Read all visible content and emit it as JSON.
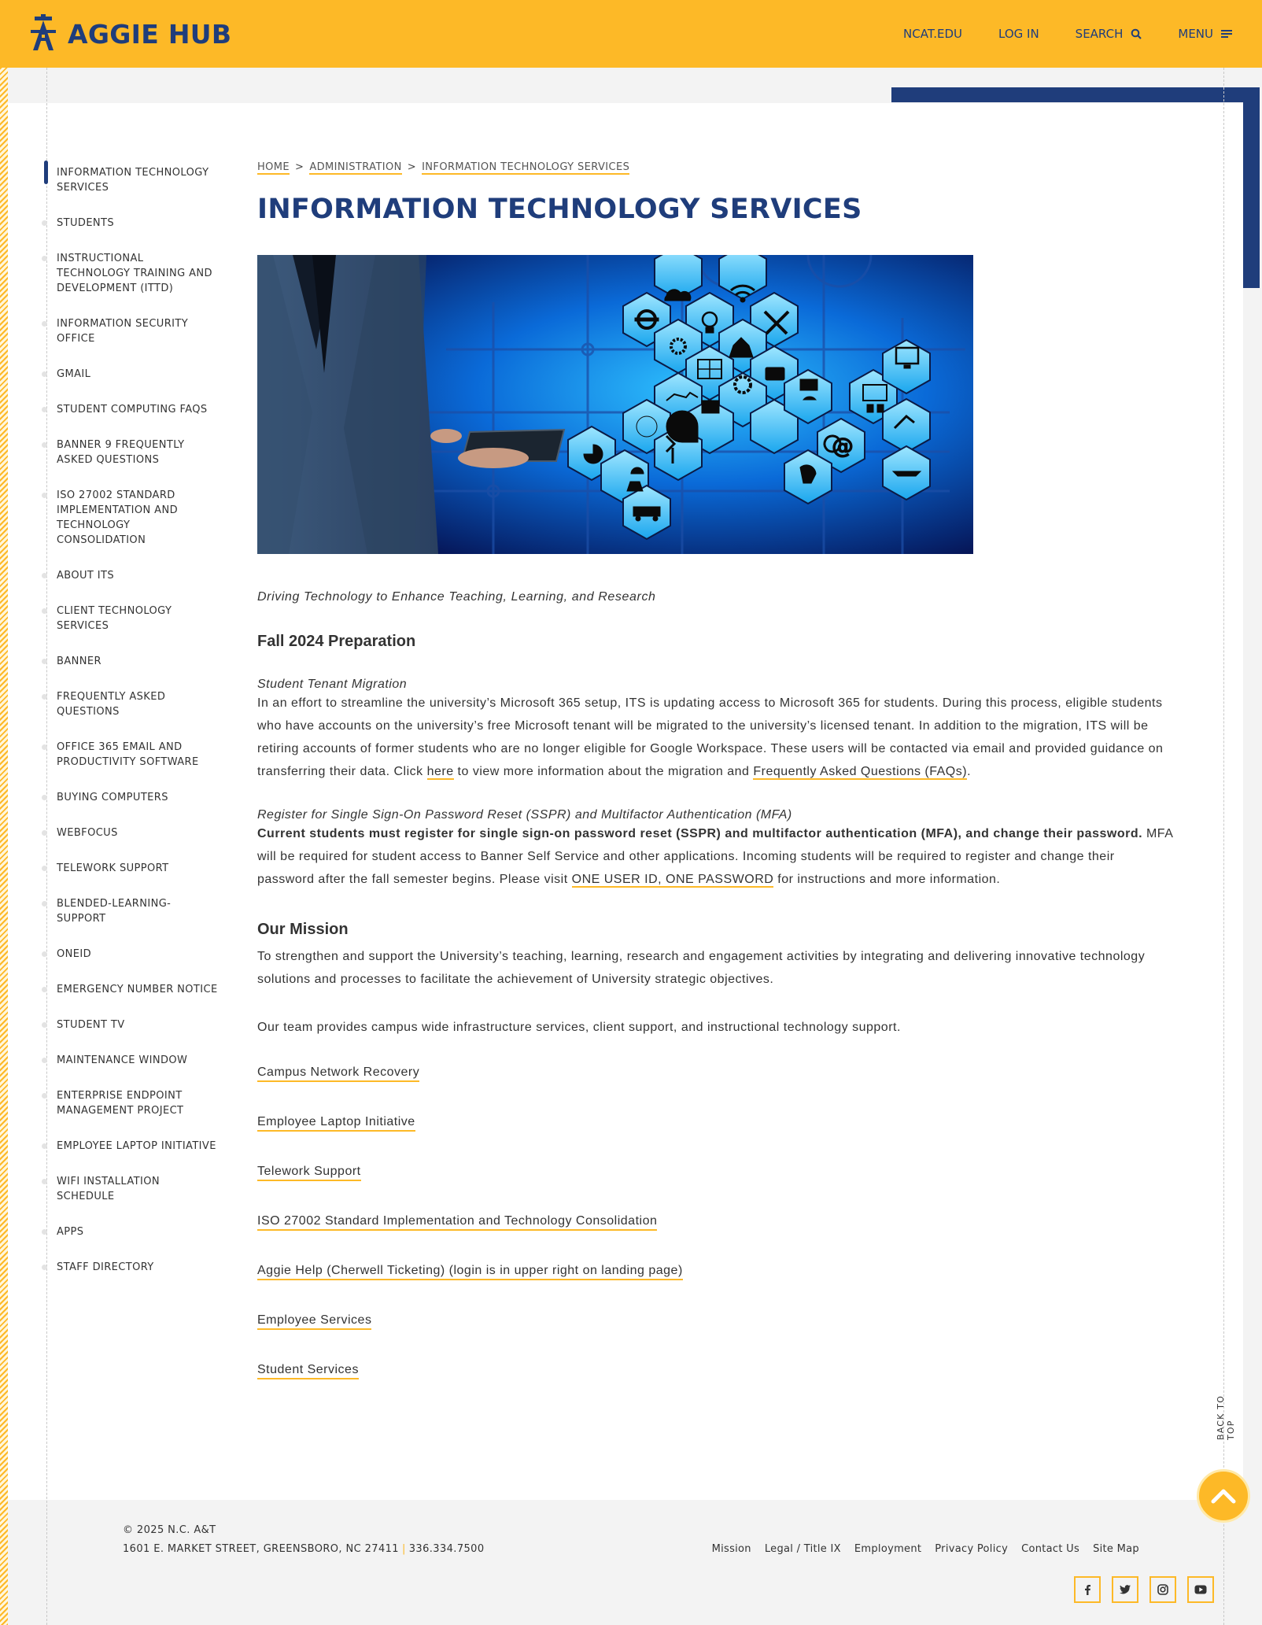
{
  "header": {
    "brand": "AGGIE HUB",
    "nav": {
      "ncat": "NCAT.EDU",
      "login": "LOG IN",
      "search": "SEARCH",
      "menu": "MENU"
    }
  },
  "sidebar": {
    "items": [
      "INFORMATION TECHNOLOGY SERVICES",
      "STUDENTS",
      "INSTRUCTIONAL TECHNOLOGY TRAINING AND DEVELOPMENT (ITTD)",
      "INFORMATION SECURITY OFFICE",
      "GMAIL",
      "STUDENT COMPUTING FAQS",
      "BANNER 9 FREQUENTLY ASKED QUESTIONS",
      "ISO 27002 STANDARD IMPLEMENTATION AND TECHNOLOGY CONSOLIDATION",
      "ABOUT ITS",
      "CLIENT TECHNOLOGY SERVICES",
      "BANNER",
      "FREQUENTLY ASKED QUESTIONS",
      "OFFICE 365 EMAIL AND PRODUCTIVITY SOFTWARE",
      "BUYING COMPUTERS",
      "WEBFOCUS",
      "TELEWORK SUPPORT",
      "BLENDED-LEARNING-SUPPORT",
      "ONEID",
      "EMERGENCY NUMBER NOTICE",
      "STUDENT TV",
      "MAINTENANCE WINDOW",
      "ENTERPRISE ENDPOINT MANAGEMENT PROJECT",
      "EMPLOYEE LAPTOP INITIATIVE",
      "WIFI INSTALLATION SCHEDULE",
      "APPS",
      "STAFF DIRECTORY"
    ]
  },
  "breadcrumb": {
    "home": "HOME",
    "admin": "ADMINISTRATION",
    "current": "INFORMATION TECHNOLOGY SERVICES",
    "sep": ">"
  },
  "main": {
    "title": "INFORMATION TECHNOLOGY SERVICES",
    "tagline": "Driving Technology to Enhance Teaching, Learning, and Research",
    "prep_heading": "Fall 2024 Preparation",
    "tenant": {
      "heading": "Student Tenant Migration",
      "text1": "In an effort to streamline the university’s Microsoft 365 setup, ITS is updating access to Microsoft 365 for students. During this process, eligible students who have accounts on the university’s free Microsoft tenant will be migrated to the university’s licensed tenant. In addition to the migration, ITS will be retiring accounts of former students who are no longer eligible for Google Workspace. These users will be contacted via email and provided guidance on transferring their data. Click ",
      "here_link": "here",
      "text2": " to view more information about the migration and ",
      "faq_link": "Frequently Asked Questions (FAQs)",
      "text3": "."
    },
    "sspr": {
      "heading": "Register for Single Sign-On Password Reset (SSPR) and Multifactor Authentication (MFA)",
      "bold": "Current students must register for single sign-on password reset (SSPR) and multifactor authentication (MFA), and change their password.",
      "text1": " MFA will be required for student access to Banner Self Service and other applications. Incoming students will be required to register and change their password after the fall semester begins. Please visit ",
      "link": "ONE USER ID, ONE PASSWORD",
      "text2": " for instructions and more information."
    },
    "mission_heading": "Our Mission",
    "mission_text": "To strengthen and support the University’s teaching, learning, research and engagement activities by integrating and delivering innovative technology solutions and processes to facilitate the achievement of University strategic objectives.",
    "team_text": "Our team provides campus wide infrastructure services, client support, and instructional technology support.",
    "links": [
      "Campus Network Recovery",
      "Employee Laptop Initiative",
      "Telework Support",
      "ISO 27002 Standard Implementation and Technology Consolidation",
      "Aggie Help (Cherwell Ticketing) (login is in upper right on landing page)",
      "Employee Services",
      "Student Services "
    ]
  },
  "back_to_top": "BACK TO TOP",
  "footer": {
    "copyright": "© 2025 N.C. A&T",
    "address": "1601 E. MARKET STREET, GREENSBORO, NC 27411",
    "divider": "|",
    "phone": "336.334.7500",
    "links": [
      "Mission",
      "Legal / Title IX",
      "Employment",
      "Privacy Policy",
      "Contact Us",
      "Site Map"
    ],
    "social_icons": [
      "facebook-icon",
      "twitter-icon",
      "instagram-icon",
      "youtube-icon"
    ]
  },
  "colors": {
    "gold": "#fdb927",
    "navy": "#1f3d7b"
  }
}
